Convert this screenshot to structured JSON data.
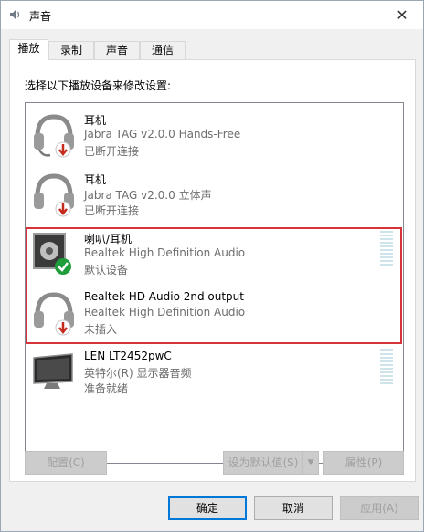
{
  "window": {
    "title": "声音",
    "close_glyph": "✕"
  },
  "tabs": [
    {
      "label": "播放",
      "active": true
    },
    {
      "label": "录制",
      "active": false
    },
    {
      "label": "声音",
      "active": false
    },
    {
      "label": "通信",
      "active": false
    }
  ],
  "instruction": "选择以下播放设备来修改设置:",
  "devices": [
    {
      "name": "耳机",
      "desc": "Jabra TAG v2.0.0 Hands-Free",
      "status": "已断开连接",
      "icon": "headset-disconnected-icon"
    },
    {
      "name": "耳机",
      "desc": "Jabra TAG v2.0.0 立体声",
      "status": "已断开连接",
      "icon": "headphones-disconnected-icon"
    },
    {
      "name": "喇叭/耳机",
      "desc": "Realtek High Definition Audio",
      "status": "默认设备",
      "icon": "speaker-default-icon"
    },
    {
      "name": "Realtek HD Audio 2nd output",
      "desc": "Realtek High Definition Audio",
      "status": "未插入",
      "icon": "headphones-unplugged-icon"
    },
    {
      "name": "LEN LT2452pwC",
      "desc": "英特尔(R) 显示器音频",
      "status": "准备就绪",
      "icon": "monitor-icon"
    }
  ],
  "buttons": {
    "configure": "配置(C)",
    "set_default": "设为默认值(S)",
    "set_default_arrow": "▼",
    "properties": "属性(P)",
    "ok": "确定",
    "cancel": "取消",
    "apply": "应用(A)"
  },
  "colors": {
    "highlight_border": "#d6343a",
    "default_check": "#1f9d3a",
    "disconnected_badge": "#c42b1c",
    "focus_border": "#0078d7"
  }
}
